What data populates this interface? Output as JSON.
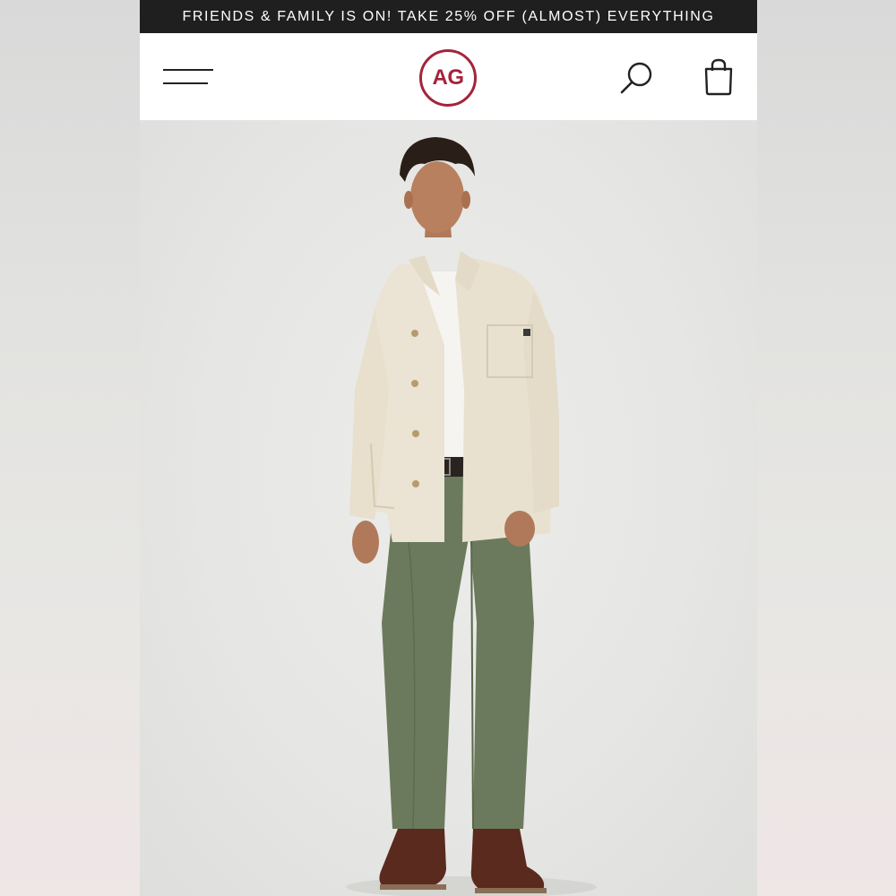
{
  "promo_banner": {
    "text": "FRIENDS & FAMILY IS ON! TAKE 25% OFF (ALMOST) EVERYTHING"
  },
  "header": {
    "logo_text": "AG",
    "menu_icon": "hamburger-menu-icon",
    "search_icon": "search-icon",
    "cart_icon": "shopping-bag-icon"
  },
  "hero": {
    "image": "product-model-photo"
  },
  "colors": {
    "banner_bg": "#1f1f1f",
    "brand": "#a3243b",
    "header_bg": "#ffffff",
    "jacket": "#ebe3d3",
    "pants": "#6b7a5c",
    "boots": "#5a2a1f"
  }
}
